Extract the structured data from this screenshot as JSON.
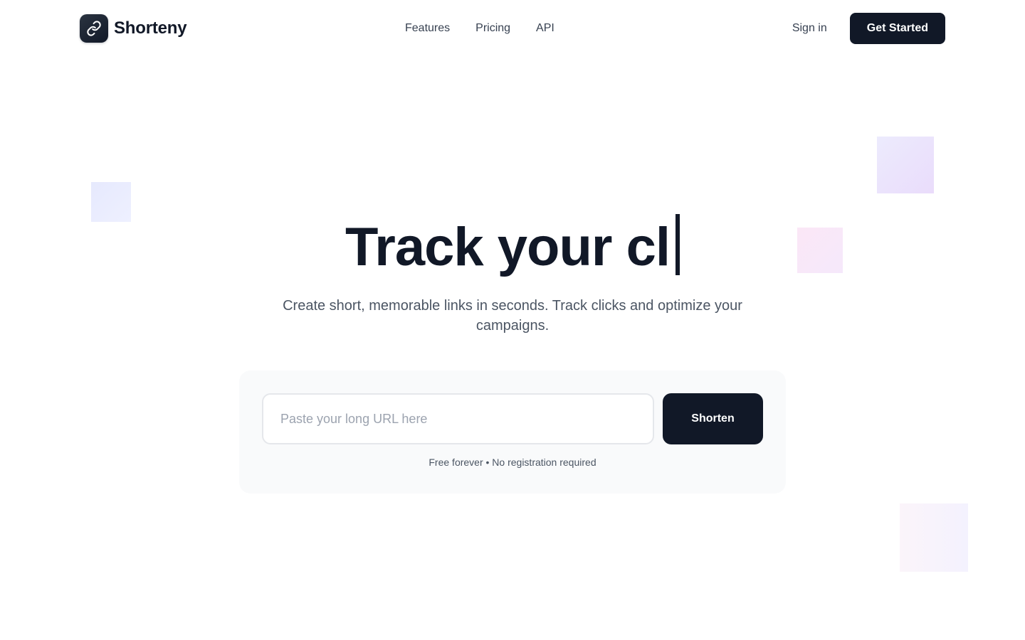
{
  "header": {
    "brand_name": "Shorteny",
    "logo_icon": "link-icon",
    "nav": [
      {
        "label": "Features"
      },
      {
        "label": "Pricing"
      },
      {
        "label": "API"
      }
    ],
    "sign_in_label": "Sign in",
    "get_started_label": "Get Started"
  },
  "hero": {
    "title_typed": "Track your cl",
    "subtitle": "Create short, memorable links in seconds. Track clicks and optimize your campaigns."
  },
  "shortener": {
    "input_value": "",
    "input_placeholder": "Paste your long URL here",
    "button_label": "Shorten",
    "note": "Free forever • No registration required"
  },
  "colors": {
    "primary": "#111827",
    "text_muted": "#4b5563",
    "card_bg": "#f9fafb"
  }
}
